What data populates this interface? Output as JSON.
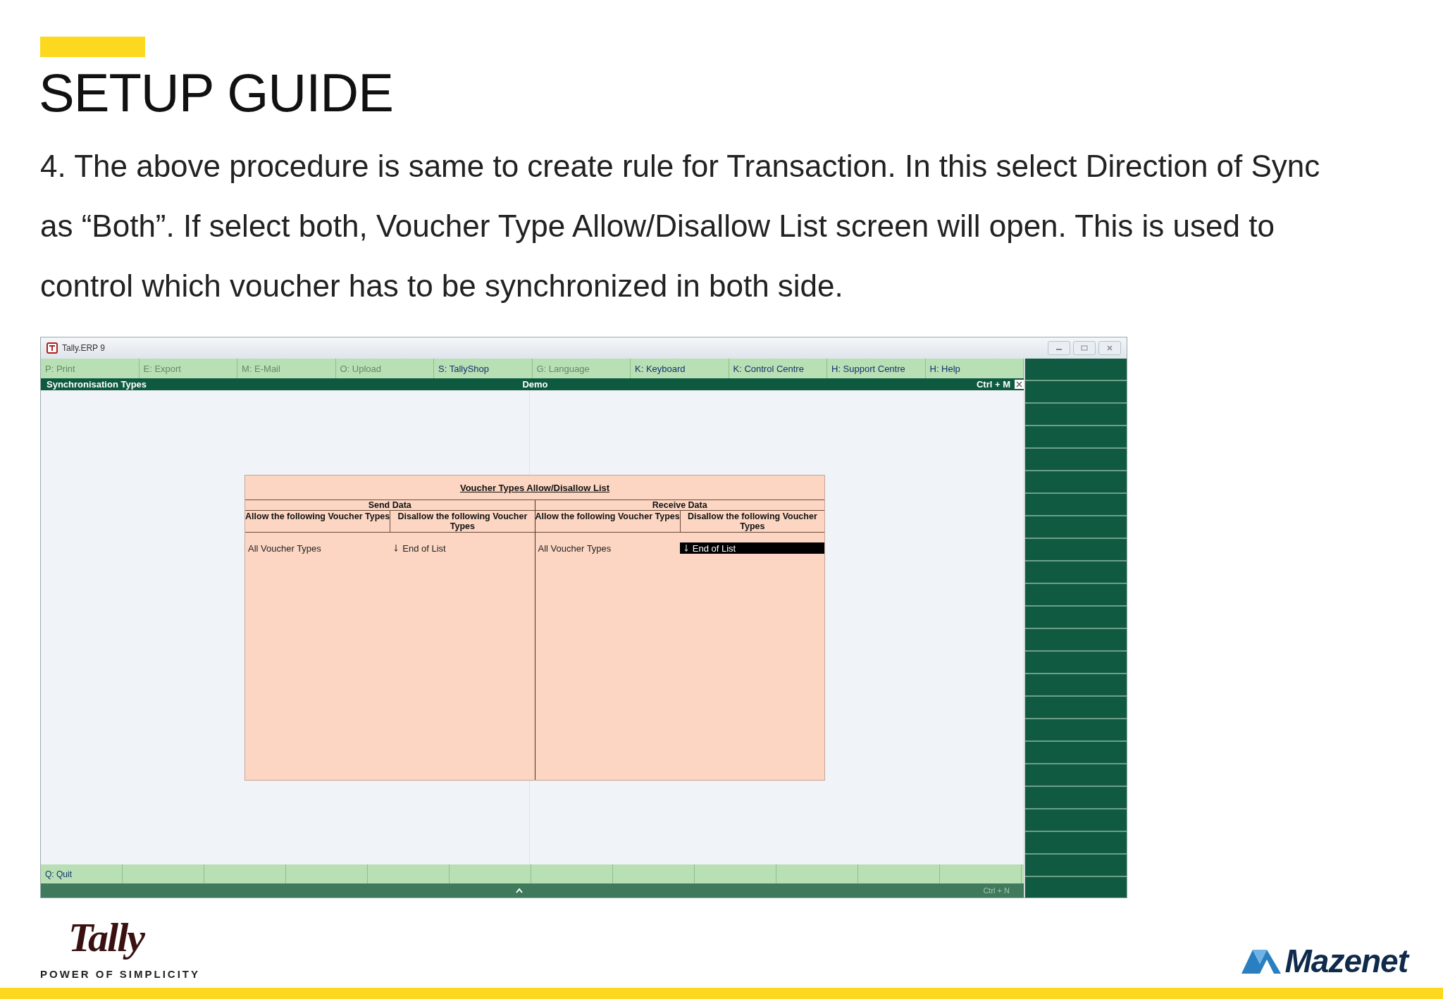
{
  "slide": {
    "title": "SETUP GUIDE",
    "paragraph": "4. The above procedure is same to create rule for Transaction. In this select Direction of Sync as “Both”. If select both, Voucher Type Allow/Disallow List screen will open. This is used to control which voucher has to be synchronized in both side."
  },
  "window": {
    "title": "Tally.ERP 9",
    "menu": [
      {
        "label": "P: Print",
        "disabled": true
      },
      {
        "label": "E: Export",
        "disabled": true
      },
      {
        "label": "M: E-Mail",
        "disabled": true
      },
      {
        "label": "O: Upload",
        "disabled": true
      },
      {
        "label": "S: TallyShop",
        "disabled": false
      },
      {
        "label": "G: Language",
        "disabled": true
      },
      {
        "label": "K: Keyboard",
        "disabled": false
      },
      {
        "label": "K: Control Centre",
        "disabled": false
      },
      {
        "label": "H: Support Centre",
        "disabled": false
      },
      {
        "label": "H: Help",
        "disabled": false
      }
    ],
    "header": {
      "title": "Synchronisation Types",
      "company": "Demo",
      "shortcut": "Ctrl + M"
    },
    "dialog": {
      "title": "Voucher Types Allow/Disallow List",
      "sections": [
        {
          "title": "Send Data",
          "columns": [
            {
              "heading": "Allow the following Voucher Types",
              "items": [
                {
                  "kind": "entry",
                  "text": "All Voucher Types",
                  "selected": false
                }
              ]
            },
            {
              "heading": "Disallow the following Voucher Types",
              "items": [
                {
                  "kind": "end",
                  "text": "End of List",
                  "selected": false
                }
              ]
            }
          ]
        },
        {
          "title": "Receive Data",
          "columns": [
            {
              "heading": "Allow the following Voucher Types",
              "items": [
                {
                  "kind": "entry",
                  "text": "All Voucher Types",
                  "selected": false
                }
              ]
            },
            {
              "heading": "Disallow the following Voucher Types",
              "items": [
                {
                  "kind": "end",
                  "text": "End of List",
                  "selected": true
                }
              ]
            }
          ]
        }
      ]
    },
    "bottom_bar": {
      "buttons": [
        "Q: Quit"
      ],
      "shortcut": "Ctrl + N"
    }
  },
  "footer": {
    "tally_logo": "Tally",
    "tagline": "POWER OF SIMPLICITY",
    "mazenet_logo": "Mazenet"
  }
}
